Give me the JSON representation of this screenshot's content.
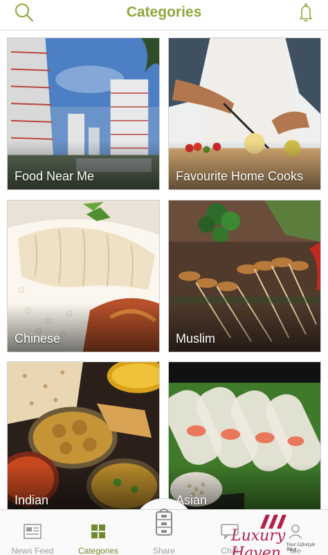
{
  "header": {
    "title": "Categories",
    "left_icon": "search-icon",
    "right_icon": "bell-icon"
  },
  "categories": [
    {
      "label": "Food Near Me"
    },
    {
      "label": "Favourite Home Cooks"
    },
    {
      "label": "Chinese"
    },
    {
      "label": "Muslim"
    },
    {
      "label": "Indian"
    },
    {
      "label": "Asian"
    }
  ],
  "tabs": [
    {
      "label": "News Feed",
      "icon": "newspaper-icon",
      "active": false
    },
    {
      "label": "Categories",
      "icon": "grid-icon",
      "active": true
    },
    {
      "label": "Share",
      "icon": "tiffin-icon",
      "active": false
    },
    {
      "label": "Chat",
      "icon": "chat-icon",
      "active": false
    },
    {
      "label": "Me",
      "icon": "person-icon",
      "active": false
    }
  ],
  "watermark": {
    "name": "Luxury Haven",
    "tagline": "Your Lifestyle Blog"
  },
  "colors": {
    "accent": "#8aa83b",
    "tab_inactive": "#9a9a9a",
    "watermark": "#b5204a"
  }
}
